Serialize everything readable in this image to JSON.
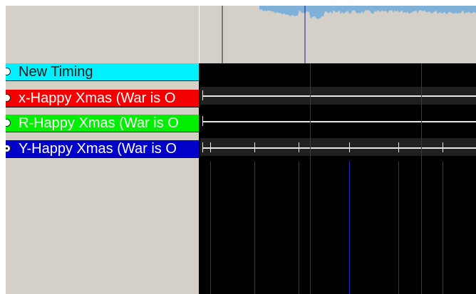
{
  "rows": [
    {
      "label": "New Timing",
      "bg": "#00f0ff",
      "fg": "#1a1a1a",
      "marker": "circle"
    },
    {
      "label": "x-Happy Xmas (War is O",
      "bg": "#f20000",
      "fg": "#ffffff",
      "marker": "circle"
    },
    {
      "label": "R-Happy Xmas (War is O",
      "bg": "#00ee00",
      "fg": "#ffffff",
      "marker": "circle"
    },
    {
      "label": "Y-Happy Xmas (War is O",
      "bg": "#0000c8",
      "fg": "#ffffff",
      "marker": "circle-dot"
    }
  ],
  "colors": {
    "panel": "#d4d0c8",
    "grid": "#000000",
    "grid_alt_row": "#202020",
    "grid_line": "#3c3c3c",
    "beat_line": "#1f2fb8",
    "playhead": "#1a1aa0",
    "waveform": "#7fb0d8",
    "timing_mark": "#e8e8e8"
  }
}
